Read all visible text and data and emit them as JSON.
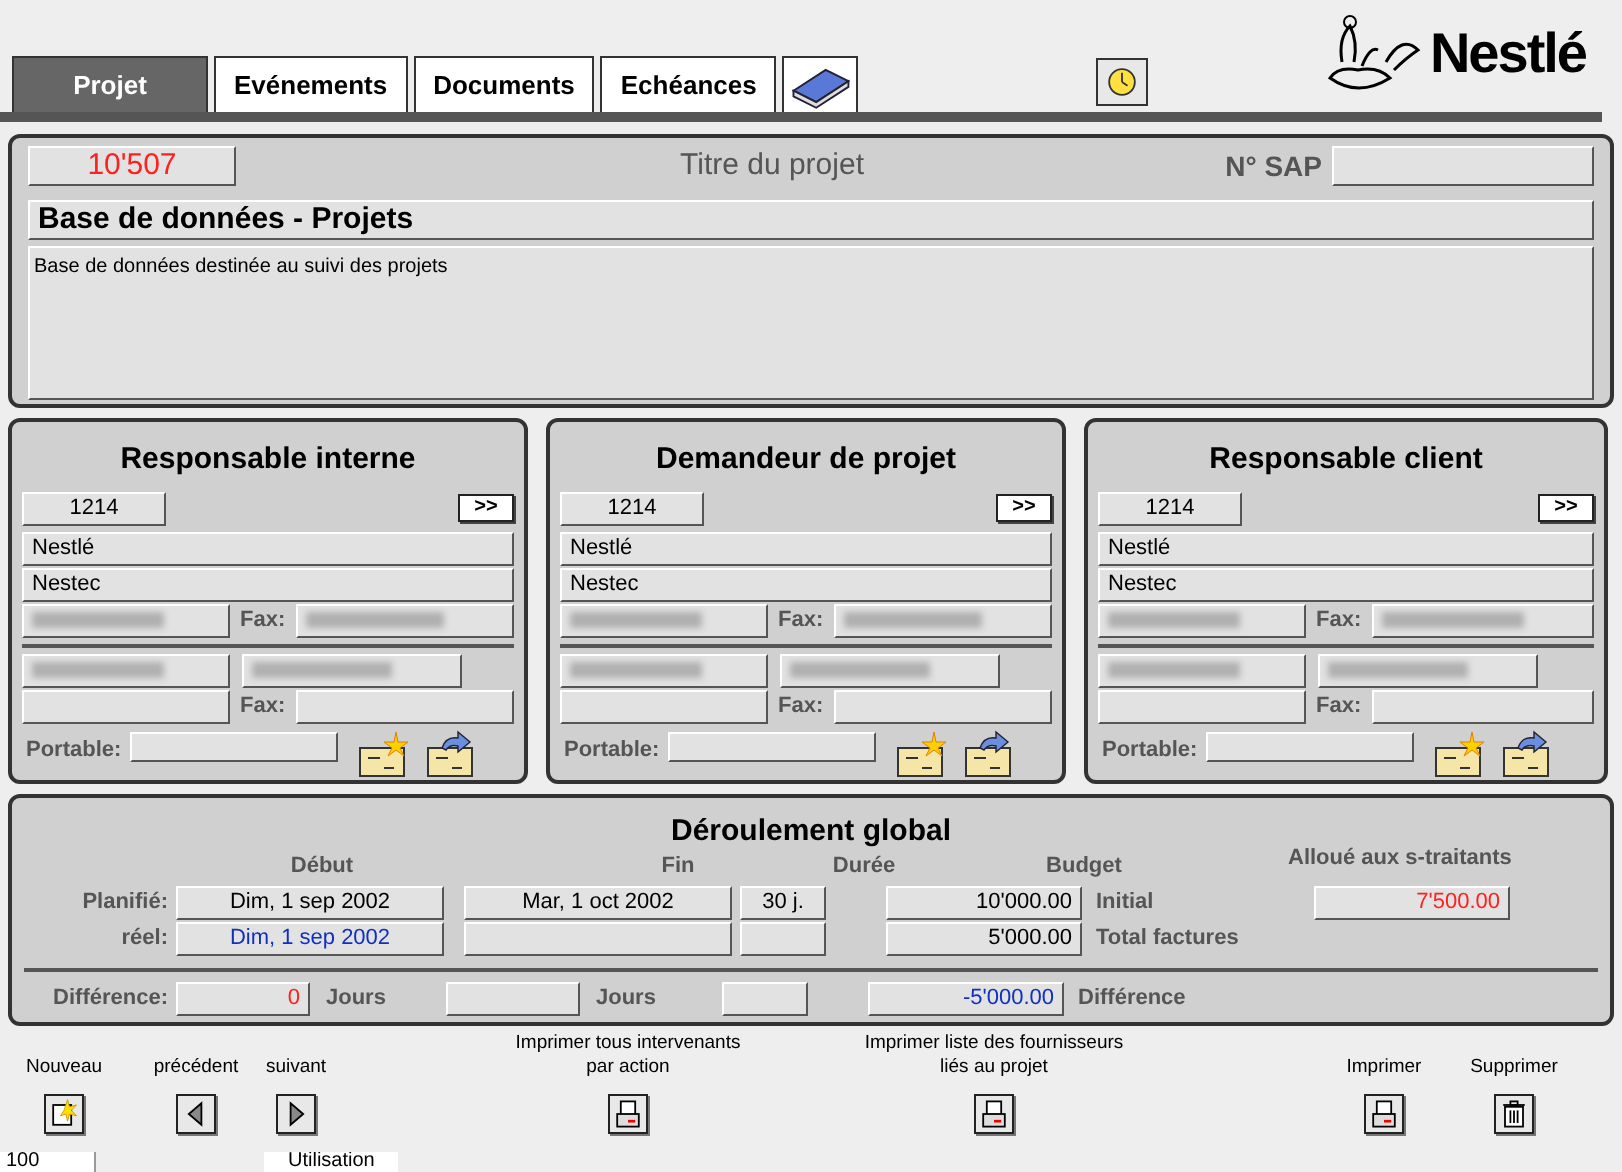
{
  "tabs": [
    {
      "label": "Projet",
      "selected": true
    },
    {
      "label": "Evénements",
      "selected": false
    },
    {
      "label": "Documents",
      "selected": false
    },
    {
      "label": "Echéances",
      "selected": false
    }
  ],
  "logo": {
    "text": "Nestlé"
  },
  "project": {
    "number": {
      "text": "10'507",
      "color": "#ff2020"
    },
    "title_label": "Titre du projet",
    "sap_label": "N° SAP",
    "name": "Base de données - Projets",
    "description": "Base de données destinée au suivi des projets"
  },
  "contacts": [
    {
      "title": "Responsable interne",
      "code": "1214",
      "more": ">>",
      "company": "Nestlé",
      "division": "Nestec",
      "fax_label": "Fax:",
      "fax_label_2": "Fax:",
      "mobile_label": "Portable:"
    },
    {
      "title": "Demandeur de projet",
      "code": "1214",
      "more": ">>",
      "company": "Nestlé",
      "division": "Nestec",
      "fax_label": "Fax:",
      "fax_label_2": "Fax:",
      "mobile_label": "Portable:"
    },
    {
      "title": "Responsable client",
      "code": "1214",
      "more": ">>",
      "company": "Nestlé",
      "division": "Nestec",
      "fax_label": "Fax:",
      "fax_label_2": "Fax:",
      "mobile_label": "Portable:"
    }
  ],
  "schedule": {
    "title": "Déroulement global",
    "columns": [
      "Début",
      "Fin",
      "Durée",
      "Budget"
    ],
    "subcontract_label": "Alloué aux s-traitants",
    "rows": [
      {
        "label": "Planifié:",
        "start": {
          "text": "Dim, 1 sep 2002",
          "color": "#000000"
        },
        "end": "Mar, 1 oct 2002",
        "duration": "30 j.",
        "budget": {
          "text": "10'000.00",
          "color": "#000000"
        },
        "budget_label": "Initial",
        "subcontract": {
          "text": "7'500.00",
          "color": "#ff2020"
        }
      },
      {
        "label": "réel:",
        "start": {
          "text": "Dim, 1 sep 2002",
          "color": "#1030c0"
        },
        "budget": {
          "text": "5'000.00",
          "color": "#000000"
        },
        "budget_label": "Total factures"
      }
    ],
    "difference": {
      "label": "Différence:",
      "days": {
        "text": "0",
        "color": "#ff2020"
      },
      "days_label": "Jours",
      "days_label_2": "Jours",
      "budget": {
        "text": "-5'000.00",
        "color": "#1030c0"
      },
      "budget_label": "Différence"
    }
  },
  "actions": [
    {
      "label": "Nouveau",
      "kind": "new"
    },
    {
      "label": "précédent",
      "kind": "prev"
    },
    {
      "label": "suivant",
      "kind": "next"
    },
    {
      "label": "Imprimer tous intervenants\npar action",
      "kind": "print"
    },
    {
      "label": "Imprimer liste des fournisseurs\nliés au projet",
      "kind": "print"
    },
    {
      "label": "Imprimer",
      "kind": "print"
    },
    {
      "label": "Supprimer",
      "kind": "trash"
    }
  ],
  "status_bar": {
    "zoom": "100",
    "mode": "Utilisation"
  }
}
